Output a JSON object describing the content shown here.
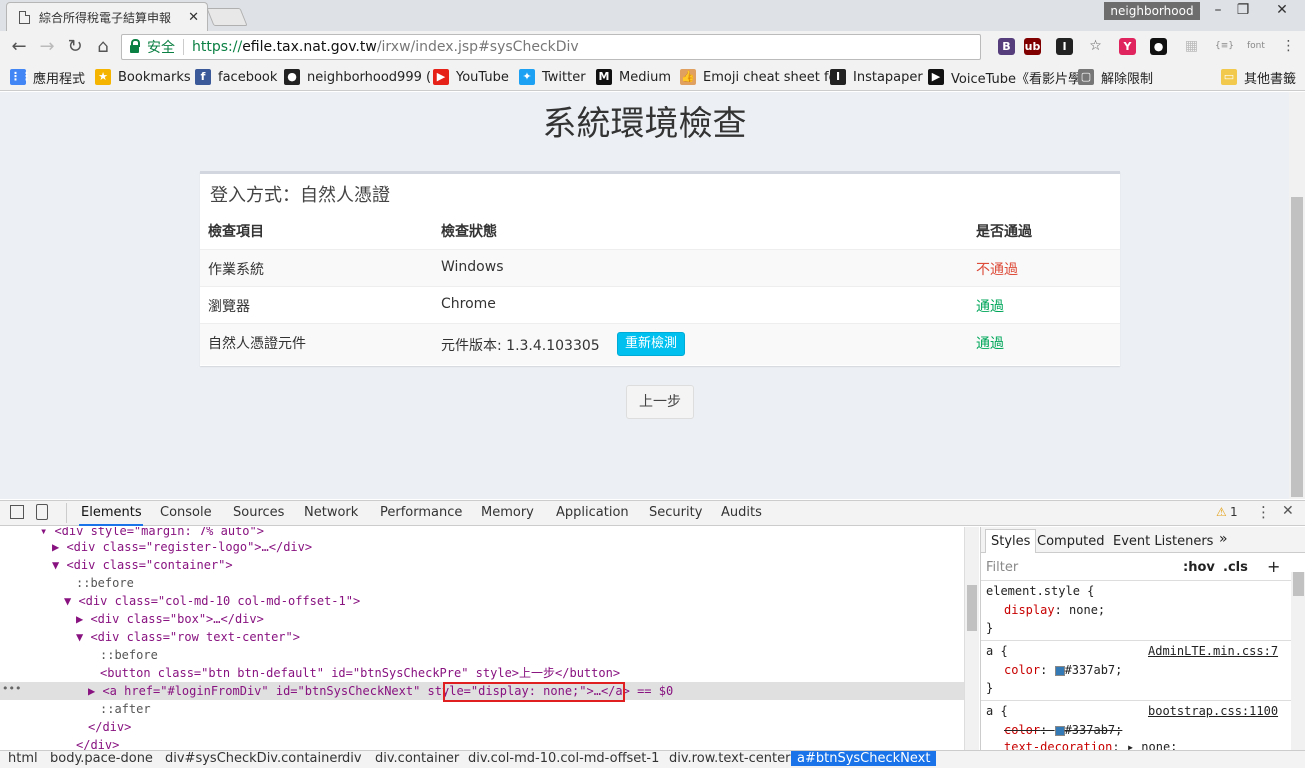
{
  "browser": {
    "tab_title": "綜合所得稅電子結算申報",
    "tab_close": "✕",
    "profile": "neighborhood",
    "window_controls": [
      "–",
      "❐",
      "✕"
    ],
    "nav": {
      "back": "←",
      "forward": "→",
      "reload": "↻",
      "home": "⌂"
    },
    "address": {
      "secure_label": "安全",
      "scheme": "https://",
      "host": "efile.tax.nat.gov.tw",
      "path": "/irxw/index.jsp#sysCheckDiv"
    },
    "extensions": [
      {
        "name": "bootstrap-ext-icon",
        "text": "B",
        "color": "#563d7c"
      },
      {
        "name": "ublock-icon",
        "text": "ub",
        "color": "#800000"
      },
      {
        "name": "instapaper-icon",
        "text": "I",
        "color": "#222222"
      },
      {
        "name": "star-icon",
        "text": "☆",
        "color": "#555555"
      },
      {
        "name": "ext-red-icon",
        "text": "Y",
        "color": "#e0245e"
      },
      {
        "name": "ext-face-icon",
        "text": "●",
        "color": "#111111"
      },
      {
        "name": "ext-grid-icon",
        "text": "▦",
        "color": "#bbbbbb"
      },
      {
        "name": "json-ext-icon",
        "text": "{≡}",
        "color": "#888888"
      },
      {
        "name": "font-ext-icon",
        "text": "font",
        "color": "#888888"
      },
      {
        "name": "menu-icon",
        "text": "⋮",
        "color": "#555555"
      }
    ],
    "bookmarks": [
      {
        "label": "應用程式",
        "icon": "apps-icon",
        "color": "#4285f4",
        "glyph": "⋮⋮"
      },
      {
        "label": "Bookmarks",
        "icon": "star-icon",
        "color": "#f5b400",
        "glyph": "★"
      },
      {
        "label": "facebook",
        "icon": "facebook-icon",
        "color": "#3b5998",
        "glyph": "f"
      },
      {
        "label": "neighborhood999 (",
        "icon": "github-icon",
        "color": "#222222",
        "glyph": "●"
      },
      {
        "label": "YouTube",
        "icon": "youtube-icon",
        "color": "#e62117",
        "glyph": "▶"
      },
      {
        "label": "Twitter",
        "icon": "twitter-icon",
        "color": "#1da1f2",
        "glyph": "✦"
      },
      {
        "label": "Medium",
        "icon": "medium-icon",
        "color": "#111111",
        "glyph": "M"
      },
      {
        "label": "Emoji cheat sheet fo",
        "icon": "thumbs-up-icon",
        "color": "#e0a060",
        "glyph": "👍"
      },
      {
        "label": "Instapaper",
        "icon": "instapaper-icon",
        "color": "#222222",
        "glyph": "I"
      },
      {
        "label": "VoiceTube《看影片學",
        "icon": "voicetube-icon",
        "color": "#111111",
        "glyph": "▶"
      },
      {
        "label": "解除限制",
        "icon": "page-icon",
        "color": "#777777",
        "glyph": "▢"
      },
      {
        "label": "其他書籤",
        "icon": "folder-icon",
        "color": "#f2c94c",
        "glyph": "▭"
      }
    ]
  },
  "page": {
    "title": "系統環境檢查",
    "login_method": "登入方式：自然人憑證",
    "columns": [
      "檢查項目",
      "檢查狀態",
      "是否通過"
    ],
    "rows": [
      {
        "item": "作業系統",
        "status": "Windows",
        "pass": "不通過",
        "pass_color": "#dd4b39"
      },
      {
        "item": "瀏覽器",
        "status": "Chrome",
        "pass": "通過",
        "pass_color": "#00a65a"
      },
      {
        "item": "自然人憑證元件",
        "status": "元件版本: 1.3.4.103305",
        "pass": "通過",
        "pass_color": "#00a65a"
      }
    ],
    "recheck_button": "重新檢測",
    "prev_button": "上一步"
  },
  "devtools": {
    "tabs": [
      "Elements",
      "Console",
      "Sources",
      "Network",
      "Performance",
      "Memory",
      "Application",
      "Security",
      "Audits"
    ],
    "warning_count": "1",
    "dom_lines": [
      "▾ <div style=\"margin: 7% auto\">",
      "▶ <div class=\"register-logo\">…</div>",
      "▼ <div class=\"container\">",
      "::before",
      "▼ <div class=\"col-md-10 col-md-offset-1\">",
      "▶ <div class=\"box\">…</div>",
      "▼ <div class=\"row text-center\">",
      "::before",
      "<button class=\"btn btn-default\" id=\"btnSysCheckPre\" style>上一步</button>",
      "▶ <a href=\"#loginFromDiv\" id=\"btnSysCheckNext\" style=\"display: none;\">…</a> == $0",
      "::after",
      "</div>",
      "</div>"
    ],
    "styles_tabs": [
      "Styles",
      "Computed",
      "Event Listeners"
    ],
    "filter_placeholder": "Filter",
    "hov": ":hov",
    "cls": ".cls",
    "rules": [
      {
        "selector": "element.style {",
        "prop": "display",
        "value": "none;",
        "source": ""
      },
      {
        "selector": "a {",
        "prop": "color",
        "value": "#337ab7;",
        "source": "AdminLTE.min.css:7"
      },
      {
        "selector": "a {",
        "prop": "color",
        "value": "#337ab7;",
        "source": "bootstrap.css:1100"
      }
    ],
    "extra_prop": {
      "prop": "text-decoration",
      "value": "none;"
    },
    "crumbs": [
      "html",
      "body.pace-done",
      "div#sysCheckDiv.container",
      "div",
      "div.container",
      "div.col-md-10.col-md-offset-1",
      "div.row.text-center",
      "a#btnSysCheckNext"
    ]
  }
}
